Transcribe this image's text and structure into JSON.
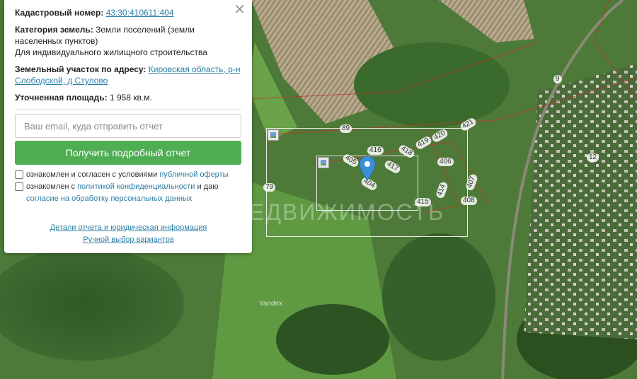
{
  "panel": {
    "cadastral_label": "Кадастровый номер:",
    "cadastral_value": "43:30:410611:404",
    "category_label": "Категория земель:",
    "category_value": "Земли поселений (земли населенных пунктов)",
    "usage": "Для индивидуального жилищного строительства",
    "address_label": "Земельный участок по адресу:",
    "address_value": "Кировская область, р-н Слободской, д Стулово",
    "area_label": "Уточненная площадь:",
    "area_value": "1 958 кв.м.",
    "email_placeholder": "Ваш email, куда отправить отчет",
    "submit_label": "Получить подробный отчет",
    "consent1_text": "ознакомлен и согласен с условиями",
    "consent1_link": "публичной оферты",
    "consent2_text": "ознакомлен с",
    "consent2_link": "политикой конфиденциальности",
    "consent2_mid": "и даю",
    "consent2_link2": "согласие на обработку персональных данных",
    "details_link": "Детали отчета и юридическая информация",
    "manual_link": "Ручной выбор вариантов",
    "close_icon": "close-icon"
  },
  "map": {
    "watermark": "ЕДВИЖИМОСТЬ",
    "provider": "Yandex",
    "plot_labels": [
      "9",
      "89",
      "421",
      "420",
      "419",
      "418",
      "416",
      "417",
      "405",
      "406",
      "404",
      "407",
      "414",
      "415",
      "408",
      "79",
      "12"
    ],
    "pin_color": "#3a8fd6"
  }
}
